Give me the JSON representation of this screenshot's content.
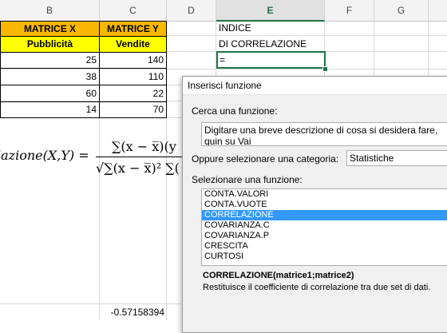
{
  "columns": [
    "B",
    "C",
    "D",
    "E",
    "F",
    "G"
  ],
  "selected_column": "E",
  "table": {
    "header1": [
      "MATRICE X",
      "MATRICE Y"
    ],
    "header2": [
      "Pubblicità",
      "Vendite"
    ],
    "rows": [
      [
        "25",
        "140"
      ],
      [
        "38",
        "110"
      ],
      [
        "60",
        "22"
      ],
      [
        "14",
        "70"
      ]
    ]
  },
  "cells": {
    "e1": "INDICE",
    "e2": "DI CORRELAZIONE",
    "e3": "=",
    "result": "-0.57158394"
  },
  "formula": {
    "lhs": "lazione(X,Y) =",
    "numerator": "∑(x − x̅)(y",
    "denominator": "√∑(x − x̅)² ∑("
  },
  "dialog": {
    "title": "Inserisci funzione",
    "search_label": "Cerca una funzione:",
    "search_text": "Digitare una breve descrizione di cosa si desidera fare, quin su Vai",
    "category_label": "Oppure selezionare una categoria:",
    "category_value": "Statistiche",
    "list_label": "Selezionare una funzione:",
    "functions": [
      "CONTA.VALORI",
      "CONTA.VUOTE",
      "CORRELAZIONE",
      "COVARIANZA.C",
      "COVARIANZA.P",
      "CRESCITA",
      "CURTOSI"
    ],
    "selected_function": "CORRELAZIONE",
    "signature": "CORRELAZIONE(matrice1;matrice2)",
    "description": "Restituisce il coefficiente di correlazione tra due set di dati."
  }
}
